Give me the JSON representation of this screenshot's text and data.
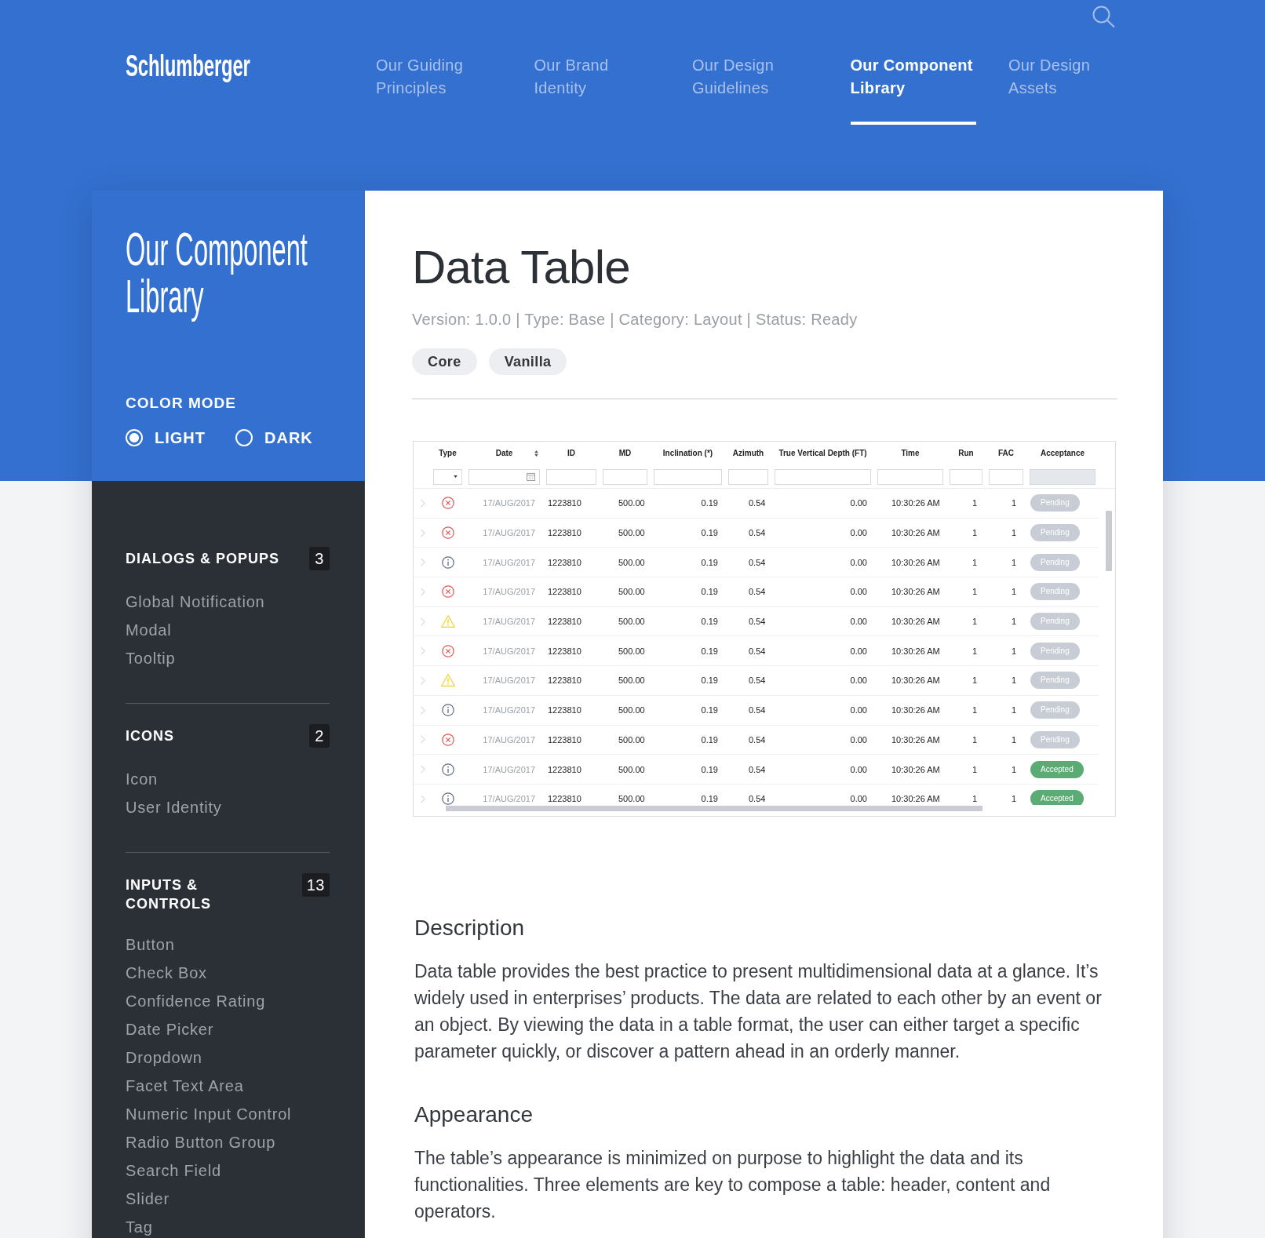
{
  "header": {
    "logo": "Schlumberger",
    "nav": [
      {
        "label": "Our Guiding Principles",
        "selected": false
      },
      {
        "label": "Our Brand Identity",
        "selected": false
      },
      {
        "label": "Our Design Guidelines",
        "selected": false
      },
      {
        "label": "Our Component Library",
        "selected": true
      },
      {
        "label": "Our Design Assets",
        "selected": false
      }
    ]
  },
  "sidebar": {
    "title": "Our Component Library",
    "color_mode": {
      "label": "COLOR MODE",
      "options": [
        {
          "label": "LIGHT",
          "selected": true
        },
        {
          "label": "DARK",
          "selected": false
        }
      ]
    },
    "sections": [
      {
        "title": "DIALOGS & POPUPS",
        "count": "3",
        "items": [
          "Global Notification",
          "Modal",
          "Tooltip"
        ]
      },
      {
        "title": "ICONS",
        "count": "2",
        "items": [
          "Icon",
          "User Identity"
        ]
      },
      {
        "title": "INPUTS & CONTROLS",
        "count": "13",
        "items": [
          "Button",
          "Check Box",
          "Confidence Rating",
          "Date Picker",
          "Dropdown",
          "Facet Text Area",
          "Numeric Input Control",
          "Radio Button Group",
          "Search Field",
          "Slider",
          "Tag"
        ]
      }
    ]
  },
  "content": {
    "title": "Data Table",
    "meta": "Version: 1.0.0 | Type: Base | Category: Layout | Status: Ready",
    "tags": [
      "Core",
      "Vanilla"
    ],
    "table": {
      "columns": [
        {
          "label": "Type",
          "sortable": false,
          "filter": {
            "kind": "select",
            "disabled": false
          }
        },
        {
          "label": "Date",
          "sortable": true,
          "filter": {
            "kind": "date",
            "disabled": false
          }
        },
        {
          "label": "ID",
          "sortable": false,
          "filter": {
            "kind": "text",
            "disabled": false
          }
        },
        {
          "label": "MD",
          "sortable": false,
          "filter": {
            "kind": "text",
            "disabled": false
          }
        },
        {
          "label": "Inclination (*)",
          "sortable": false,
          "filter": {
            "kind": "text",
            "disabled": false
          }
        },
        {
          "label": "Azimuth",
          "sortable": false,
          "filter": {
            "kind": "text",
            "disabled": false
          }
        },
        {
          "label": "True Vertical Depth (FT)",
          "sortable": false,
          "filter": {
            "kind": "text",
            "disabled": false
          }
        },
        {
          "label": "Time",
          "sortable": false,
          "filter": {
            "kind": "text",
            "disabled": false
          }
        },
        {
          "label": "Run",
          "sortable": false,
          "filter": {
            "kind": "text",
            "disabled": false
          }
        },
        {
          "label": "FAC",
          "sortable": false,
          "filter": {
            "kind": "text",
            "disabled": false
          }
        },
        {
          "label": "Acceptance",
          "sortable": false,
          "filter": {
            "kind": "text",
            "disabled": true
          }
        }
      ],
      "rows": [
        {
          "expanded": false,
          "cells": [
            {
              "kind": "error"
            },
            "17/AUG/2017",
            "1223810",
            "500.00",
            "0.19",
            "0.54",
            "0.00",
            "10:30:26 AM",
            "1",
            "1",
            {
              "label": "Pending",
              "color": "#c8cdd5"
            }
          ]
        },
        {
          "expanded": false,
          "cells": [
            {
              "kind": "error"
            },
            "17/AUG/2017",
            "1223810",
            "500.00",
            "0.19",
            "0.54",
            "0.00",
            "10:30:26 AM",
            "1",
            "1",
            {
              "label": "Pending",
              "color": "#c8cdd5"
            }
          ]
        },
        {
          "expanded": false,
          "cells": [
            {
              "kind": "info"
            },
            "17/AUG/2017",
            "1223810",
            "500.00",
            "0.19",
            "0.54",
            "0.00",
            "10:30:26 AM",
            "1",
            "1",
            {
              "label": "Pending",
              "color": "#c8cdd5"
            }
          ]
        },
        {
          "expanded": false,
          "cells": [
            {
              "kind": "error"
            },
            "17/AUG/2017",
            "1223810",
            "500.00",
            "0.19",
            "0.54",
            "0.00",
            "10:30:26 AM",
            "1",
            "1",
            {
              "label": "Pending",
              "color": "#c8cdd5"
            }
          ]
        },
        {
          "expanded": false,
          "cells": [
            {
              "kind": "warning"
            },
            "17/AUG/2017",
            "1223810",
            "500.00",
            "0.19",
            "0.54",
            "0.00",
            "10:30:26 AM",
            "1",
            "1",
            {
              "label": "Pending",
              "color": "#c8cdd5"
            }
          ]
        },
        {
          "expanded": false,
          "cells": [
            {
              "kind": "error"
            },
            "17/AUG/2017",
            "1223810",
            "500.00",
            "0.19",
            "0.54",
            "0.00",
            "10:30:26 AM",
            "1",
            "1",
            {
              "label": "Pending",
              "color": "#c8cdd5"
            }
          ]
        },
        {
          "expanded": false,
          "cells": [
            {
              "kind": "warning"
            },
            "17/AUG/2017",
            "1223810",
            "500.00",
            "0.19",
            "0.54",
            "0.00",
            "10:30:26 AM",
            "1",
            "1",
            {
              "label": "Pending",
              "color": "#c8cdd5"
            }
          ]
        },
        {
          "expanded": false,
          "cells": [
            {
              "kind": "info"
            },
            "17/AUG/2017",
            "1223810",
            "500.00",
            "0.19",
            "0.54",
            "0.00",
            "10:30:26 AM",
            "1",
            "1",
            {
              "label": "Pending",
              "color": "#c8cdd5"
            }
          ]
        },
        {
          "expanded": false,
          "cells": [
            {
              "kind": "error"
            },
            "17/AUG/2017",
            "1223810",
            "500.00",
            "0.19",
            "0.54",
            "0.00",
            "10:30:26 AM",
            "1",
            "1",
            {
              "label": "Pending",
              "color": "#c8cdd5"
            }
          ]
        },
        {
          "expanded": false,
          "cells": [
            {
              "kind": "info"
            },
            "17/AUG/2017",
            "1223810",
            "500.00",
            "0.19",
            "0.54",
            "0.00",
            "10:30:26 AM",
            "1",
            "1",
            {
              "label": "Accepted",
              "color": "#5aab74"
            }
          ]
        },
        {
          "expanded": false,
          "cells": [
            {
              "kind": "info"
            },
            "17/AUG/2017",
            "1223810",
            "500.00",
            "0.19",
            "0.54",
            "0.00",
            "10:30:26 AM",
            "1",
            "1",
            {
              "label": "Accepted",
              "color": "#5aab74"
            }
          ]
        }
      ]
    },
    "sections": [
      {
        "heading": "Description",
        "text": "Data table provides the best practice to present multidimensional data at a glance. It’s widely used in enterprises’ products. The data are related to each other by an event or an object. By viewing the data in a table format, the user can either target a specific parameter quickly, or discover a pattern ahead in an orderly manner."
      },
      {
        "heading": "Appearance",
        "text": "The table’s appearance is minimized on purpose to highlight the data and its functionalities. Three elements are key to compose a table: header, content and operators."
      }
    ]
  }
}
